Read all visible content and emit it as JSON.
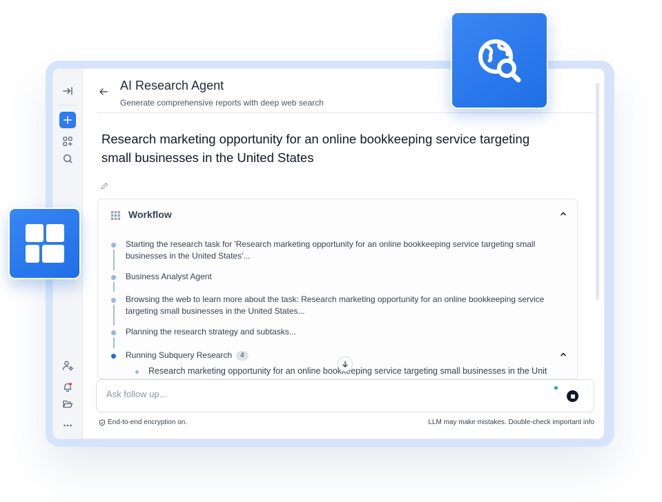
{
  "app": {
    "title": "AI Research Agent",
    "subtitle": "Generate comprehensive reports with deep web search"
  },
  "sidebar": {
    "items": [
      {
        "name": "collapse-sidebar",
        "icon": "collapse-right-icon"
      },
      {
        "name": "new-chat",
        "icon": "plus-icon"
      },
      {
        "name": "apps",
        "icon": "apps-add-icon"
      },
      {
        "name": "search",
        "icon": "search-icon"
      },
      {
        "name": "user-settings",
        "icon": "users-gear-icon"
      },
      {
        "name": "notifications",
        "icon": "bell-icon"
      },
      {
        "name": "folder",
        "icon": "folder-open-icon"
      },
      {
        "name": "more",
        "icon": "more-icon"
      }
    ]
  },
  "query": "Research marketing opportunity for an online bookkeeping service targeting small businesses in the United States",
  "workflow": {
    "title": "Workflow",
    "steps": [
      "Starting the research task for 'Research marketing opportunity for an online bookkeeping service targeting small businesses in the United States'...",
      "Business Analyst Agent",
      "Browsing the web to learn more about the task: Research marketing opportunity for an online bookkeeping service targeting small businesses in the United States...",
      "Planning the research strategy and subtasks...",
      "Running Subquery Research"
    ],
    "subquery_count": "4",
    "substep": "Research marketing opportunity for an online bookkeeping service targeting small businesses in the Unit"
  },
  "input": {
    "placeholder": "Ask follow up..."
  },
  "footer": {
    "encryption": "End-to-end encryption on.",
    "disclaimer": "LLM may make mistakes. Double-check important info"
  },
  "colors": {
    "accent": "#2f7bf0",
    "frame": "#d6e4fb",
    "step_dot": "#93b4ee",
    "active_dot": "#2563eb",
    "status_green": "#22b07d"
  }
}
